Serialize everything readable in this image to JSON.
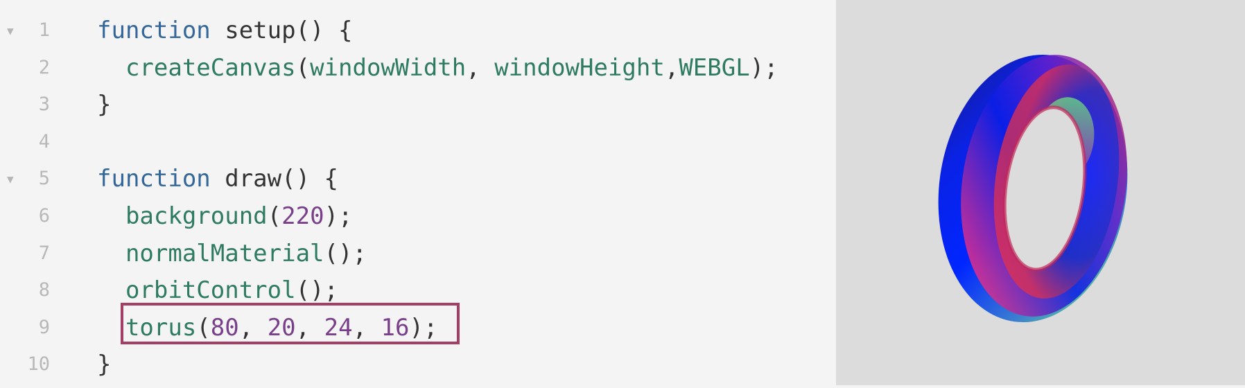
{
  "editor": {
    "lines": [
      {
        "num": "1",
        "fold": "▼",
        "tokens": [
          {
            "t": "function",
            "c": "kw"
          },
          {
            "t": " setup() {",
            "c": "pun"
          }
        ]
      },
      {
        "num": "2",
        "fold": "",
        "tokens": [
          {
            "t": "  ",
            "c": "pun"
          },
          {
            "t": "createCanvas",
            "c": "fn"
          },
          {
            "t": "(",
            "c": "pun"
          },
          {
            "t": "windowWidth",
            "c": "fn"
          },
          {
            "t": ", ",
            "c": "pun"
          },
          {
            "t": "windowHeight",
            "c": "fn"
          },
          {
            "t": ",",
            "c": "pun"
          },
          {
            "t": "WEBGL",
            "c": "fn"
          },
          {
            "t": ");",
            "c": "pun"
          }
        ]
      },
      {
        "num": "3",
        "fold": "",
        "tokens": [
          {
            "t": "}",
            "c": "pun"
          }
        ]
      },
      {
        "num": "4",
        "fold": "",
        "tokens": []
      },
      {
        "num": "5",
        "fold": "▼",
        "tokens": [
          {
            "t": "function",
            "c": "kw"
          },
          {
            "t": " draw() {",
            "c": "pun"
          }
        ]
      },
      {
        "num": "6",
        "fold": "",
        "tokens": [
          {
            "t": "  ",
            "c": "pun"
          },
          {
            "t": "background",
            "c": "fn"
          },
          {
            "t": "(",
            "c": "pun"
          },
          {
            "t": "220",
            "c": "num"
          },
          {
            "t": ");",
            "c": "pun"
          }
        ]
      },
      {
        "num": "7",
        "fold": "",
        "tokens": [
          {
            "t": "  ",
            "c": "pun"
          },
          {
            "t": "normalMaterial",
            "c": "fn"
          },
          {
            "t": "();",
            "c": "pun"
          }
        ]
      },
      {
        "num": "8",
        "fold": "",
        "tokens": [
          {
            "t": "  ",
            "c": "pun"
          },
          {
            "t": "orbitControl",
            "c": "fn"
          },
          {
            "t": "();",
            "c": "pun"
          }
        ]
      },
      {
        "num": "9",
        "fold": "",
        "tokens": [
          {
            "t": "  ",
            "c": "pun"
          },
          {
            "t": "torus",
            "c": "fn"
          },
          {
            "t": "(",
            "c": "pun"
          },
          {
            "t": "80",
            "c": "num"
          },
          {
            "t": ", ",
            "c": "pun"
          },
          {
            "t": "20",
            "c": "num"
          },
          {
            "t": ", ",
            "c": "pun"
          },
          {
            "t": "24",
            "c": "num"
          },
          {
            "t": ", ",
            "c": "pun"
          },
          {
            "t": "16",
            "c": "num"
          },
          {
            "t": ");",
            "c": "pun"
          }
        ]
      },
      {
        "num": "10",
        "fold": "",
        "tokens": [
          {
            "t": "}",
            "c": "pun"
          }
        ]
      }
    ],
    "highlighted_line": "9"
  },
  "canvas": {
    "background": "#dcdcdc",
    "object": "torus"
  },
  "colors": {
    "keyword": "#336699",
    "function": "#2e7b62",
    "number": "#7a3f8b",
    "highlight_border": "#a33e64"
  }
}
